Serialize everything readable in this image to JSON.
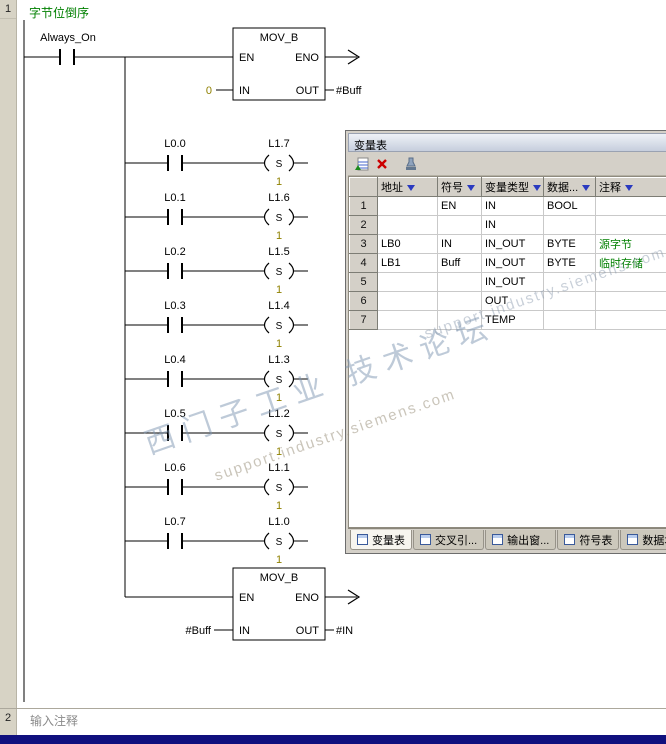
{
  "network1": {
    "number": "1",
    "title": "字节位倒序",
    "always_on": "Always_On",
    "mov_top": {
      "name": "MOV_B",
      "en": "EN",
      "eno": "ENO",
      "in": "IN",
      "out": "OUT",
      "in_value": "0",
      "out_value": "#Buff"
    },
    "mov_bottom": {
      "name": "MOV_B",
      "en": "EN",
      "eno": "ENO",
      "in": "IN",
      "out": "OUT",
      "in_value": "#Buff",
      "out_value": "#IN"
    },
    "branches": [
      {
        "contact": "L0.0",
        "coil": "L1.7",
        "op": "S",
        "count": "1"
      },
      {
        "contact": "L0.1",
        "coil": "L1.6",
        "op": "S",
        "count": "1"
      },
      {
        "contact": "L0.2",
        "coil": "L1.5",
        "op": "S",
        "count": "1"
      },
      {
        "contact": "L0.3",
        "coil": "L1.4",
        "op": "S",
        "count": "1"
      },
      {
        "contact": "L0.4",
        "coil": "L1.3",
        "op": "S",
        "count": "1"
      },
      {
        "contact": "L0.5",
        "coil": "L1.2",
        "op": "S",
        "count": "1"
      },
      {
        "contact": "L0.6",
        "coil": "L1.1",
        "op": "S",
        "count": "1"
      },
      {
        "contact": "L0.7",
        "coil": "L1.0",
        "op": "S",
        "count": "1"
      }
    ]
  },
  "network2": {
    "number": "2",
    "comment": "输入注释"
  },
  "var_table": {
    "title": "变量表",
    "columns": {
      "addr": "地址",
      "symbol": "符号",
      "type": "变量类型",
      "data": "数据...",
      "comment": "注释"
    },
    "rows": [
      {
        "num": "1",
        "addr": "",
        "symbol": "EN",
        "type": "IN",
        "data": "BOOL",
        "comment": ""
      },
      {
        "num": "2",
        "addr": "",
        "symbol": "",
        "type": "IN",
        "data": "",
        "comment": ""
      },
      {
        "num": "3",
        "addr": "LB0",
        "symbol": "IN",
        "type": "IN_OUT",
        "data": "BYTE",
        "comment": "源字节"
      },
      {
        "num": "4",
        "addr": "LB1",
        "symbol": "Buff",
        "type": "IN_OUT",
        "data": "BYTE",
        "comment": "临时存储"
      },
      {
        "num": "5",
        "addr": "",
        "symbol": "",
        "type": "IN_OUT",
        "data": "",
        "comment": ""
      },
      {
        "num": "6",
        "addr": "",
        "symbol": "",
        "type": "OUT",
        "data": "",
        "comment": ""
      },
      {
        "num": "7",
        "addr": "",
        "symbol": "",
        "type": "TEMP",
        "data": "",
        "comment": ""
      }
    ],
    "tabs": [
      {
        "label": "变量表"
      },
      {
        "label": "交叉引..."
      },
      {
        "label": "输出窗..."
      },
      {
        "label": "符号表"
      },
      {
        "label": "数据块"
      }
    ]
  },
  "watermark": {
    "title": "西门子工业 技术论坛",
    "url": "support.industry.siemens.com"
  }
}
